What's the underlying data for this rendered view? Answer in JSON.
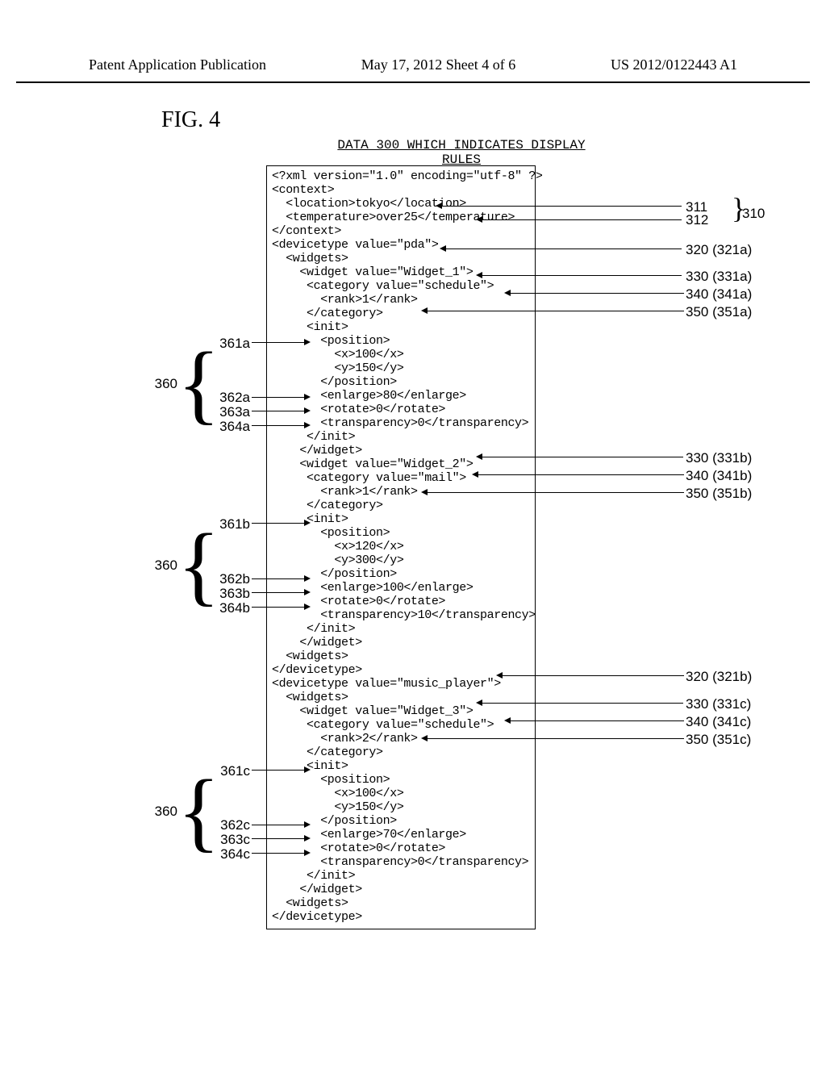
{
  "header": {
    "left": "Patent Application Publication",
    "center": "May 17, 2012  Sheet 4 of 6",
    "right": "US 2012/0122443 A1"
  },
  "figure": {
    "caption": "FIG. 4",
    "subtitle": "DATA 300 WHICH INDICATES DISPLAY RULES"
  },
  "code": "<?xml version=\"1.0\" encoding=\"utf-8\" ?>\n<context>\n  <location>tokyo</location>\n  <temperature>over25</temperature>\n</context>\n<devicetype value=\"pda\">\n  <widgets>\n    <widget value=\"Widget_1\">\n     <category value=\"schedule\">\n       <rank>1</rank>\n     </category>\n     <init>\n       <position>\n         <x>100</x>\n         <y>150</y>\n       </position>\n       <enlarge>80</enlarge>\n       <rotate>0</rotate>\n       <transparency>0</transparency>\n     </init>\n    </widget>\n    <widget value=\"Widget_2\">\n     <category value=\"mail\">\n       <rank>1</rank>\n     </category>\n     <init>\n       <position>\n         <x>120</x>\n         <y>300</y>\n       </position>\n       <enlarge>100</enlarge>\n       <rotate>0</rotate>\n       <transparency>10</transparency>\n     </init>\n    </widget>\n  <widgets>\n</devicetype>\n<devicetype value=\"music_player\">\n  <widgets>\n    <widget value=\"Widget_3\">\n     <category value=\"schedule\">\n       <rank>2</rank>\n     </category>\n     <init>\n       <position>\n         <x>100</x>\n         <y>150</y>\n       </position>\n       <enlarge>70</enlarge>\n       <rotate>0</rotate>\n       <transparency>0</transparency>\n     </init>\n    </widget>\n  <widgets>\n</devicetype>",
  "labels": {
    "r311": "311",
    "r312": "312",
    "r310": "310",
    "r320a": "320 (321a)",
    "r330a": "330 (331a)",
    "r340a": "340 (341a)",
    "r350a": "350 (351a)",
    "r330b": "330 (331b)",
    "r340b": "340 (341b)",
    "r350b": "350 (351b)",
    "r320b": "320 (321b)",
    "r330c": "330 (331c)",
    "r340c": "340 (341c)",
    "r350c": "350 (351c)",
    "l361a": "361a",
    "l362a": "362a",
    "l363a": "363a",
    "l364a": "364a",
    "l361b": "361b",
    "l362b": "362b",
    "l363b": "363b",
    "l364b": "364b",
    "l361c": "361c",
    "l362c": "362c",
    "l363c": "363c",
    "l364c": "364c",
    "l360": "360"
  }
}
